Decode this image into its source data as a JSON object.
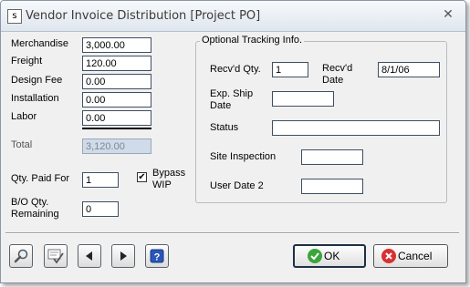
{
  "window": {
    "title": "Vendor Invoice Distribution [Project PO]"
  },
  "costs": {
    "merchandise_label": "Merchandise",
    "merchandise_value": "3,000.00",
    "freight_label": "Freight",
    "freight_value": "120.00",
    "design_fee_label": "Design Fee",
    "design_fee_value": "0.00",
    "installation_label": "Installation",
    "installation_value": "0.00",
    "labor_label": "Labor",
    "labor_value": "0.00",
    "total_label": "Total",
    "total_value": "3,120.00"
  },
  "qty": {
    "paid_for_label": "Qty. Paid For",
    "paid_for_value": "1",
    "bypass_wip_label_1": "Bypass",
    "bypass_wip_label_2": "WIP",
    "bypass_wip_checked": true,
    "bypass_wip_glyph": "✔",
    "bo_remaining_label_1": "B/O Qty.",
    "bo_remaining_label_2": "Remaining",
    "bo_remaining_value": "0"
  },
  "tracking": {
    "group_title": "Optional Tracking Info.",
    "recvd_qty_label": "Recv'd Qty.",
    "recvd_qty_value": "1",
    "recvd_date_label_1": "Recv'd",
    "recvd_date_label_2": "Date",
    "recvd_date_value": "8/1/06",
    "exp_ship_label_1": "Exp. Ship",
    "exp_ship_label_2": "Date",
    "exp_ship_value": "",
    "status_label": "Status",
    "status_value": "",
    "site_inspection_label": "Site Inspection",
    "site_inspection_value": "",
    "user_date2_label": "User Date 2",
    "user_date2_value": ""
  },
  "toolbar": {
    "icons": [
      "search-icon",
      "spell-check-icon",
      "previous-icon",
      "next-icon",
      "help-icon"
    ]
  },
  "buttons": {
    "ok_label": "OK",
    "cancel_label": "Cancel"
  },
  "colors": {
    "ok_icon": "#3aa53a",
    "cancel_icon": "#d93030",
    "disabled_field": "#cfdbe8",
    "help_icon": "#2b56b8"
  }
}
